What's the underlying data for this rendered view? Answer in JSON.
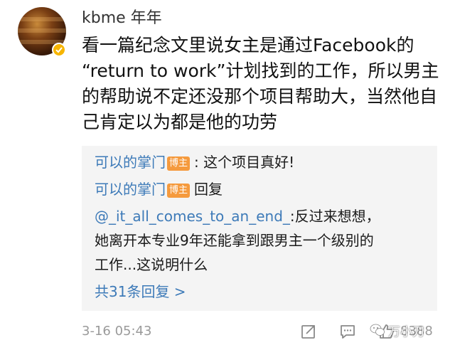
{
  "post": {
    "username": "kbme 年年",
    "content_lines": [
      "看一篇纪念文里说女主是通过Facebook的",
      "“return to work”计划找到的工作，所以男主",
      "的帮助说不定还没那个项目帮助大，当然他自",
      "己肯定以为都是他的功劳"
    ]
  },
  "replies": {
    "items": [
      {
        "author": "可以的掌门",
        "badge": "博主",
        "text": ": 这个项目真好!"
      },
      {
        "author": "可以的掌门",
        "badge": "博主",
        "action": "回复",
        "mention": "@_it_all_comes_to_an_end_",
        "text_first": ":反过来想想，",
        "text_lines": [
          "她离开本专业9年还能拿到跟男主一个级别的",
          "工作...这说明什么"
        ]
      }
    ],
    "more_label": "共31条回复 >"
  },
  "footer": {
    "timestamp": "3-16 05:43",
    "like_count": "8388",
    "watermark": "万小刀",
    "icons": [
      "share-icon",
      "comment-icon",
      "like-icon"
    ]
  },
  "colors": {
    "link": "#3d7ab8",
    "badge": "#f59a3d",
    "verified": "#f7b500",
    "reply_bg": "#f4f4f4",
    "meta": "#9a9a9a"
  }
}
